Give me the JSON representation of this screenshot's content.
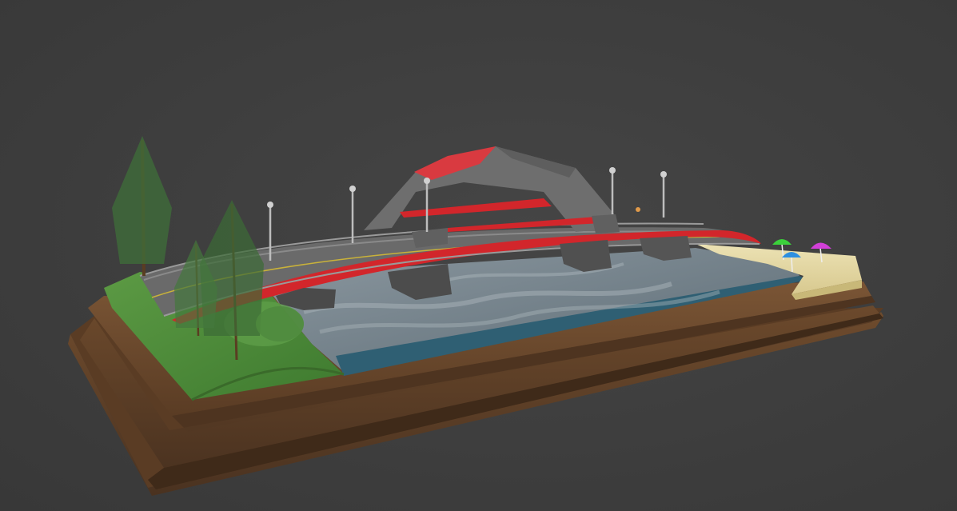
{
  "scene": {
    "colors": {
      "background": "#3e3e3e",
      "wood_base": "#6b4a2e",
      "wood_dark": "#4a3220",
      "water": "#7d8a93",
      "water_deep": "#2f5f73",
      "grass": "#4e8a3a",
      "sand": "#e3d7a4",
      "bridge_gray": "#6f6f6f",
      "bridge_red": "#d2262b",
      "umbrella_green": "#3bd13b",
      "umbrella_blue": "#2d8fe0",
      "umbrella_magenta": "#d23fd8"
    },
    "objects": [
      "wooden-display-base",
      "river-water",
      "grass-bank",
      "sand-beach",
      "arched-bridge",
      "bridge-canopy",
      "street-lamps",
      "pine-trees",
      "beach-umbrellas"
    ]
  }
}
